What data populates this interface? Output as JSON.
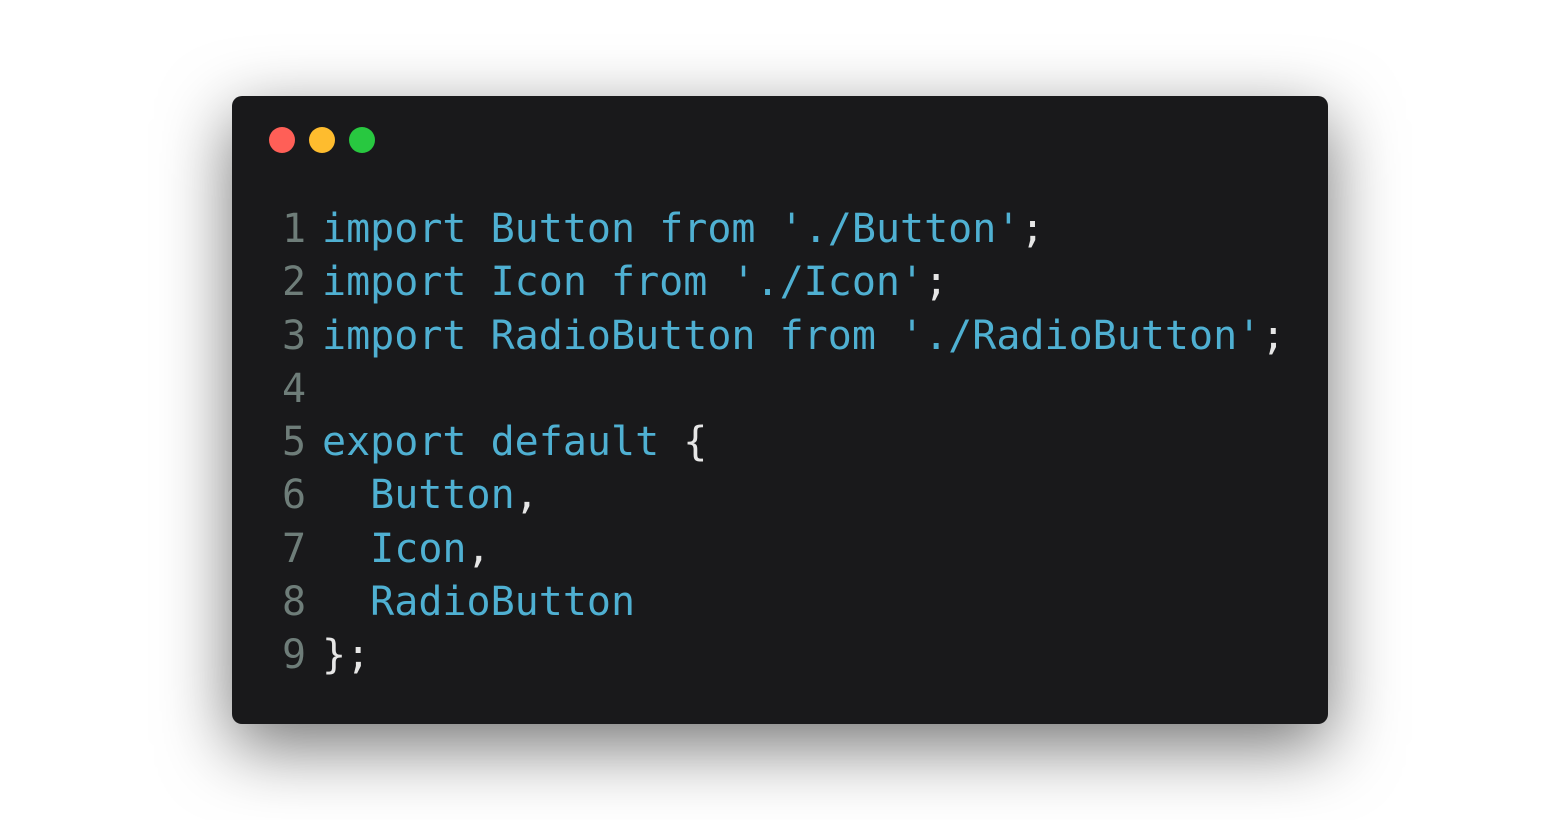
{
  "window": {
    "controls": [
      {
        "name": "close",
        "color": "#ff5f57"
      },
      {
        "name": "minimize",
        "color": "#febc2e"
      },
      {
        "name": "maximize",
        "color": "#28c840"
      }
    ]
  },
  "code": {
    "lines": [
      {
        "number": "1",
        "tokens": [
          {
            "type": "kw",
            "text": "import"
          },
          {
            "type": "pu",
            "text": " "
          },
          {
            "type": "id",
            "text": "Button"
          },
          {
            "type": "pu",
            "text": " "
          },
          {
            "type": "kw",
            "text": "from"
          },
          {
            "type": "pu",
            "text": " "
          },
          {
            "type": "str",
            "text": "'./Button'"
          },
          {
            "type": "pu",
            "text": ";"
          }
        ]
      },
      {
        "number": "2",
        "tokens": [
          {
            "type": "kw",
            "text": "import"
          },
          {
            "type": "pu",
            "text": " "
          },
          {
            "type": "id",
            "text": "Icon"
          },
          {
            "type": "pu",
            "text": " "
          },
          {
            "type": "kw",
            "text": "from"
          },
          {
            "type": "pu",
            "text": " "
          },
          {
            "type": "str",
            "text": "'./Icon'"
          },
          {
            "type": "pu",
            "text": ";"
          }
        ]
      },
      {
        "number": "3",
        "tokens": [
          {
            "type": "kw",
            "text": "import"
          },
          {
            "type": "pu",
            "text": " "
          },
          {
            "type": "id",
            "text": "RadioButton"
          },
          {
            "type": "pu",
            "text": " "
          },
          {
            "type": "kw",
            "text": "from"
          },
          {
            "type": "pu",
            "text": " "
          },
          {
            "type": "str",
            "text": "'./RadioButton'"
          },
          {
            "type": "pu",
            "text": ";"
          }
        ]
      },
      {
        "number": "4",
        "tokens": []
      },
      {
        "number": "5",
        "tokens": [
          {
            "type": "kw",
            "text": "export"
          },
          {
            "type": "pu",
            "text": " "
          },
          {
            "type": "kw",
            "text": "default"
          },
          {
            "type": "pu",
            "text": " {"
          }
        ]
      },
      {
        "number": "6",
        "tokens": [
          {
            "type": "pu",
            "text": "  "
          },
          {
            "type": "id",
            "text": "Button"
          },
          {
            "type": "pu",
            "text": ","
          }
        ]
      },
      {
        "number": "7",
        "tokens": [
          {
            "type": "pu",
            "text": "  "
          },
          {
            "type": "id",
            "text": "Icon"
          },
          {
            "type": "pu",
            "text": ","
          }
        ]
      },
      {
        "number": "8",
        "tokens": [
          {
            "type": "pu",
            "text": "  "
          },
          {
            "type": "id",
            "text": "RadioButton"
          }
        ]
      },
      {
        "number": "9",
        "tokens": [
          {
            "type": "pu",
            "text": "};"
          }
        ]
      }
    ]
  }
}
